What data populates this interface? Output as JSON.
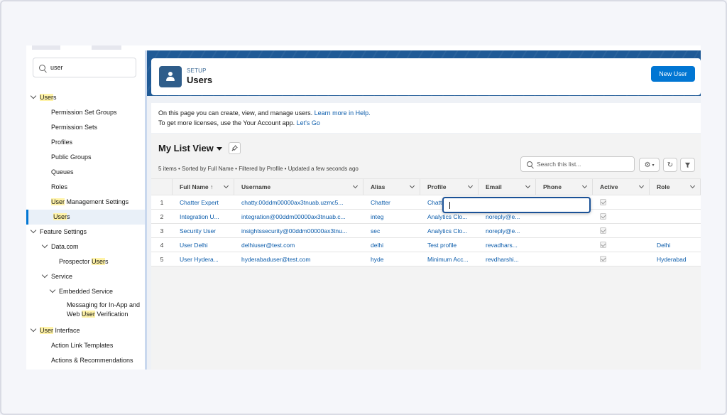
{
  "sidebar": {
    "search_value": "user",
    "items": [
      {
        "label_pre": "",
        "label_hl": "User",
        "label_post": "s",
        "level": 0,
        "chevron": "down"
      },
      {
        "label_pre": "Permission Set Groups",
        "label_hl": "",
        "label_post": "",
        "level": 1
      },
      {
        "label_pre": "Permission Sets",
        "label_hl": "",
        "label_post": "",
        "level": 1
      },
      {
        "label_pre": "Profiles",
        "label_hl": "",
        "label_post": "",
        "level": 1
      },
      {
        "label_pre": "Public Groups",
        "label_hl": "",
        "label_post": "",
        "level": 1
      },
      {
        "label_pre": "Queues",
        "label_hl": "",
        "label_post": "",
        "level": 1
      },
      {
        "label_pre": "Roles",
        "label_hl": "",
        "label_post": "",
        "level": 1
      },
      {
        "label_pre": "",
        "label_hl": "User",
        "label_post": " Management Settings",
        "level": 1
      },
      {
        "label_pre": "",
        "label_hl": "User",
        "label_post": "s",
        "level": 1,
        "selected": true
      },
      {
        "label_pre": "Feature Settings",
        "label_hl": "",
        "label_post": "",
        "level": 0,
        "chevron": "down"
      },
      {
        "label_pre": "Data.com",
        "label_hl": "",
        "label_post": "",
        "level": 1,
        "chevron": "down"
      },
      {
        "label_pre": "Prospector ",
        "label_hl": "User",
        "label_post": "s",
        "level": 2
      },
      {
        "label_pre": "Service",
        "label_hl": "",
        "label_post": "",
        "level": 1,
        "chevron": "down"
      },
      {
        "label_pre": "Embedded Service",
        "label_hl": "",
        "label_post": "",
        "level": 2,
        "chevron": "down"
      },
      {
        "label_pre": "Messaging for In-App and",
        "label_hl": "",
        "label_post": "",
        "level": 3,
        "line2_pre": "Web ",
        "line2_hl": "User",
        "line2_post": " Verification"
      },
      {
        "label_pre": "",
        "label_hl": "User",
        "label_post": " Interface",
        "level": 0,
        "chevron": "down"
      },
      {
        "label_pre": "Action Link Templates",
        "label_hl": "",
        "label_post": "",
        "level": 1
      },
      {
        "label_pre": "Actions & Recommendations",
        "label_hl": "",
        "label_post": "",
        "level": 1
      }
    ]
  },
  "header": {
    "eyebrow": "SETUP",
    "title": "Users",
    "new_button": "New User",
    "icon": "user-icon"
  },
  "info": {
    "line1_text": "On this page you can create, view, and manage users. ",
    "line1_link": "Learn more in Help.",
    "line2_text": "To get more licenses, use the Your Account app. ",
    "line2_link": "Let's Go"
  },
  "list": {
    "title": "My List View",
    "meta": "5 items • Sorted by Full Name • Filtered by Profile • Updated a few seconds ago",
    "search_placeholder": "Search this list...",
    "columns": [
      "Full Name ↑",
      "Username",
      "Alias",
      "Profile",
      "Email",
      "Phone",
      "Active",
      "Role"
    ],
    "rows": [
      {
        "num": "1",
        "name": "Chatter Expert",
        "username": "chatty.00ddm00000ax3tnuab.uzmc5...",
        "alias": "Chatter",
        "profile": "Chatte",
        "email": "",
        "phone": "",
        "active": true,
        "role": ""
      },
      {
        "num": "2",
        "name": "Integration U...",
        "username": "integration@00ddm00000ax3tnuab.c...",
        "alias": "integ",
        "profile": "Analytics Clo...",
        "email": "noreply@e...",
        "phone": "",
        "active": true,
        "role": ""
      },
      {
        "num": "3",
        "name": "Security User",
        "username": "insightssecurity@00ddm00000ax3tnu...",
        "alias": "sec",
        "profile": "Analytics Clo...",
        "email": "noreply@e...",
        "phone": "",
        "active": true,
        "role": ""
      },
      {
        "num": "4",
        "name": "User Delhi",
        "username": "delhiuser@test.com",
        "alias": "delhi",
        "profile": "Test profile",
        "email": "revadhars...",
        "phone": "",
        "active": true,
        "role": "Delhi"
      },
      {
        "num": "5",
        "name": "User Hydera...",
        "username": "hyderabaduser@test.com",
        "alias": "hyde",
        "profile": "Minimum Acc...",
        "email": "revdharshi...",
        "phone": "",
        "active": true,
        "role": "Hyderabad"
      }
    ]
  },
  "colors": {
    "brand_blue": "#0176d3",
    "link": "#0b5cab",
    "highlight": "#fff3a8",
    "frame_blue": "#1f5a96"
  }
}
